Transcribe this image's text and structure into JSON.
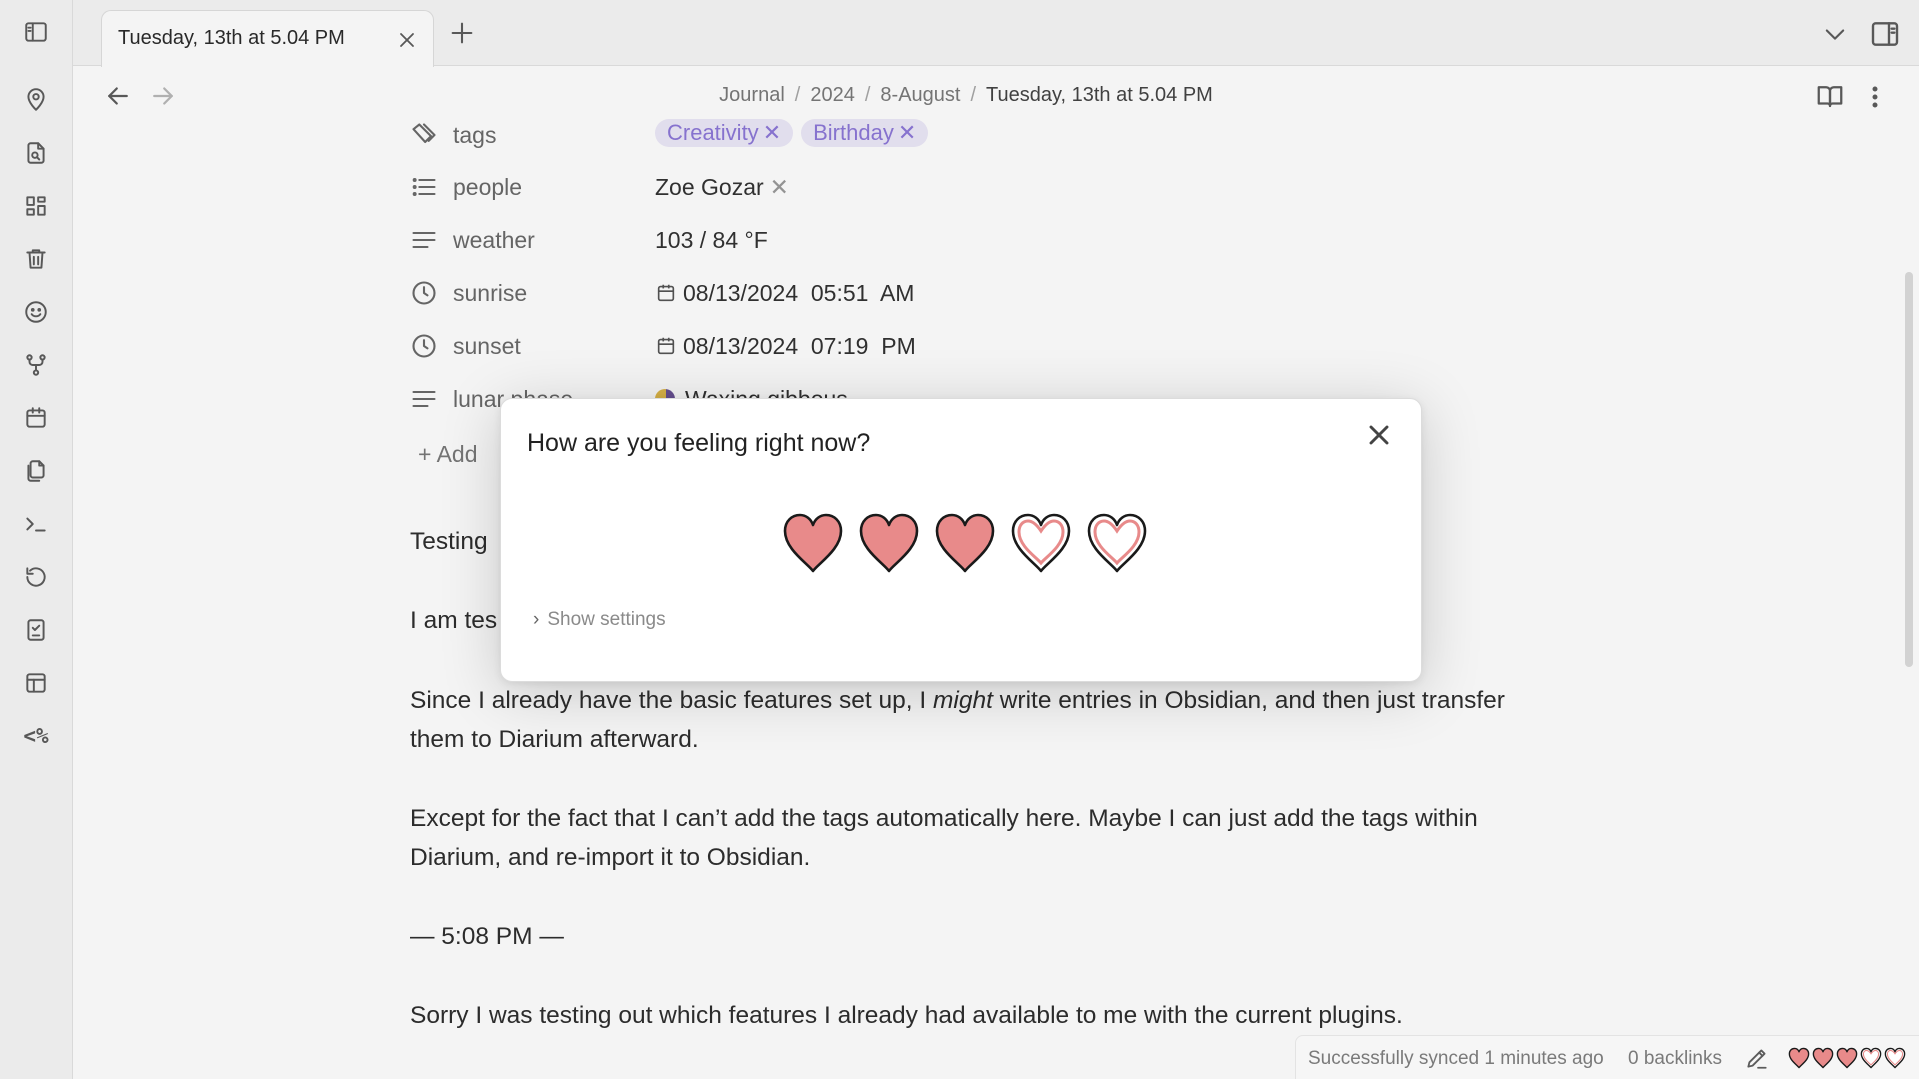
{
  "tab": {
    "title": "Tuesday, 13th at 5.04 PM"
  },
  "breadcrumb": [
    "Journal",
    "2024",
    "8-August",
    "Tuesday, 13th at 5.04 PM"
  ],
  "properties": {
    "tags": {
      "key": "tags",
      "values": [
        "Creativity",
        "Birthday"
      ]
    },
    "people": {
      "key": "people",
      "value": "Zoe Gozar"
    },
    "weather": {
      "key": "weather",
      "value": "103 / 84 °F"
    },
    "sunrise": {
      "key": "sunrise",
      "value": "08/13/2024  05:51  AM"
    },
    "sunset": {
      "key": "sunset",
      "value": "08/13/2024  07:19  PM"
    },
    "lunar_phase": {
      "key": "lunar phase",
      "value": "Waxing gibbous"
    },
    "add_label": "Add"
  },
  "body": {
    "p1": "Testing",
    "p2": "I am tes",
    "p3_a": "Since I already have the basic features set up, I ",
    "p3_em": "might",
    "p3_b": " write entries in Obsidian, and then just transfer them to Diarium afterward.",
    "p4": "Except for the fact that I can’t add the tags automatically here. Maybe I can just add the tags within Diarium, and re-import it to Obsidian.",
    "p5": "— 5:08 PM —",
    "p6": "Sorry I was testing out which features I already had available to me with the current plugins."
  },
  "modal": {
    "title": "How are you feeling right now?",
    "rating": 3,
    "max_rating": 5,
    "show_settings": "Show settings"
  },
  "statusbar": {
    "sync": "Successfully synced 1 minutes ago",
    "backlinks": "0 backlinks",
    "rating": 3,
    "max_rating": 5
  },
  "colors": {
    "heart_fill": "#e88a8a",
    "tag_bg": "#ece8f8",
    "tag_text": "#8d78d8"
  },
  "icons": {
    "ribbon": [
      "sidebar-toggle-icon",
      "map-pin-icon",
      "file-search-icon",
      "dashboard-icon",
      "trash-icon",
      "smiley-icon",
      "git-fork-icon",
      "calendar-icon",
      "copy-files-icon",
      "terminal-icon",
      "history-icon",
      "bookmark-icon",
      "layout-icon",
      "templater-icon"
    ]
  }
}
